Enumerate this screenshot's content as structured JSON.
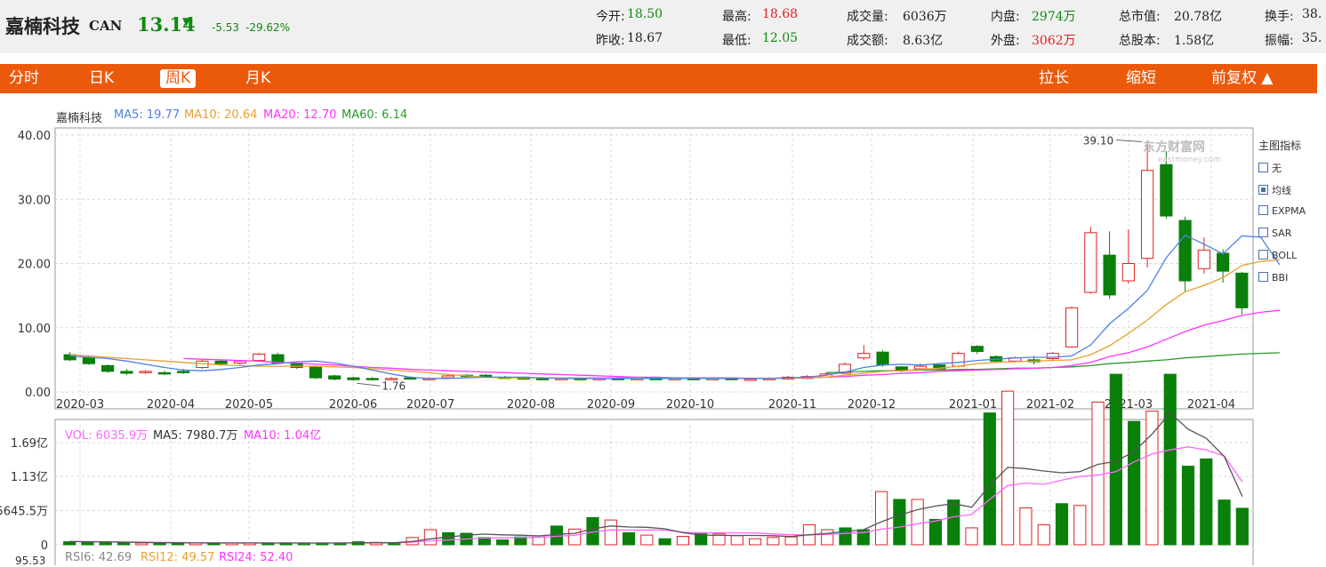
{
  "quote": {
    "name": "嘉楠科技",
    "code": "CAN",
    "price": "13.14",
    "change": "-5.53",
    "change_pct": "-29.62%",
    "arrow": "▼",
    "open_label": "今开:",
    "open": "18.50",
    "prev_close_label": "昨收:",
    "prev_close": "18.67",
    "high_label": "最高:",
    "high": "18.68",
    "low_label": "最低:",
    "low": "12.05",
    "volume_label": "成交量:",
    "volume": "6036万",
    "amount_label": "成交额:",
    "amount": "8.63亿",
    "inner_label": "内盘:",
    "inner": "2974万",
    "outer_label": "外盘:",
    "outer": "3062万",
    "mktcap_label": "总市值:",
    "mktcap": "20.78亿",
    "shares_label": "总股本:",
    "shares": "1.58亿",
    "turnover_label": "换手:",
    "turnover": "38.",
    "amplitude_label": "振幅:",
    "amplitude": "35."
  },
  "toolbar": {
    "tabs": [
      "分时",
      "日K",
      "周K",
      "月K"
    ],
    "active_tab": "周K",
    "stretch": "拉长",
    "shrink": "缩短",
    "adjust": "前复权 ▲"
  },
  "main_legend": {
    "name": "嘉楠科技",
    "ma5": "MA5: 19.77",
    "ma10": "MA10: 20.64",
    "ma20": "MA20: 12.70",
    "ma60": "MA60: 6.14"
  },
  "vol_legend": {
    "vol": "VOL: 6035.9万",
    "ma5": "MA5: 7980.7万",
    "ma10": "MA10: 1.04亿"
  },
  "rsi_legend": {
    "rsi6": "RSI6: 42.69",
    "rsi12": "RSI12: 49.57",
    "rsi24": "RSI24: 52.40",
    "top_tick": "95.53"
  },
  "indicators": {
    "title": "主图指标",
    "items": [
      {
        "label": "无",
        "checked": false
      },
      {
        "label": "均线",
        "checked": true
      },
      {
        "label": "EXPMA",
        "checked": false
      },
      {
        "label": "SAR",
        "checked": false
      },
      {
        "label": "BOLL",
        "checked": false
      },
      {
        "label": "BBI",
        "checked": false
      }
    ]
  },
  "watermark": {
    "cn": "东方财富网",
    "en": "eastmoney.com"
  },
  "colors": {
    "up": "#e02020",
    "down": "#0a7f0a",
    "ma5": "#4f80e8",
    "ma10": "#e8a030",
    "ma20": "#ff33ff",
    "ma60": "#2a9a2a",
    "accent": "#eb5a0b"
  },
  "chart_data": [
    {
      "type": "candlestick",
      "title": "",
      "y_ticks": [
        "40.00",
        "30.00",
        "20.00",
        "10.00",
        "0.00"
      ],
      "ylim": [
        0,
        41
      ],
      "x_ticks": [
        "2020-03",
        "2020-04",
        "2020-05",
        "2020-06",
        "2020-07",
        "2020-08",
        "2020-09",
        "2020-10",
        "2020-11",
        "2020-12",
        "2021-01",
        "2021-02",
        "2021-03",
        "2021-04"
      ],
      "annotations": [
        {
          "text": "39.10"
        },
        {
          "text": "1.76"
        }
      ],
      "candles": [
        [
          5.8,
          5.0,
          6.2,
          4.8
        ],
        [
          5.3,
          4.4,
          5.6,
          4.2
        ],
        [
          4.1,
          3.2,
          4.3,
          3.0
        ],
        [
          3.2,
          2.9,
          3.6,
          2.6
        ],
        [
          3.0,
          3.2,
          3.4,
          2.8
        ],
        [
          3.0,
          2.8,
          3.3,
          2.6
        ],
        [
          3.2,
          3.0,
          3.6,
          2.8
        ],
        [
          3.8,
          4.8,
          5.0,
          3.6
        ],
        [
          4.8,
          4.4,
          5.1,
          4.1
        ],
        [
          4.5,
          4.8,
          5.0,
          4.2
        ],
        [
          4.9,
          5.9,
          6.1,
          4.7
        ],
        [
          5.8,
          4.5,
          6.1,
          4.3
        ],
        [
          4.5,
          3.8,
          4.6,
          3.6
        ],
        [
          3.9,
          2.2,
          4.1,
          2.0
        ],
        [
          2.5,
          2.0,
          2.7,
          1.8
        ],
        [
          2.2,
          1.9,
          2.4,
          1.76
        ],
        [
          2.1,
          2.0,
          2.3,
          1.8
        ],
        [
          2.0,
          2.1,
          2.3,
          1.8
        ],
        [
          2.2,
          2.0,
          2.4,
          1.9
        ],
        [
          2.0,
          2.1,
          2.3,
          1.9
        ],
        [
          2.2,
          2.5,
          2.8,
          2.1
        ],
        [
          2.6,
          2.5,
          2.8,
          2.3
        ],
        [
          2.6,
          2.3,
          2.8,
          2.2
        ],
        [
          2.3,
          2.2,
          2.5,
          2.1
        ],
        [
          2.3,
          2.0,
          2.4,
          1.9
        ],
        [
          2.1,
          1.9,
          2.3,
          1.8
        ],
        [
          2.0,
          2.1,
          2.2,
          1.9
        ],
        [
          2.1,
          2.0,
          2.2,
          1.8
        ],
        [
          2.0,
          2.1,
          2.3,
          1.9
        ],
        [
          2.1,
          2.0,
          2.2,
          1.9
        ],
        [
          2.0,
          2.1,
          2.2,
          1.9
        ],
        [
          2.1,
          2.0,
          2.2,
          1.9
        ],
        [
          2.0,
          2.1,
          2.3,
          1.9
        ],
        [
          2.1,
          2.0,
          2.2,
          1.9
        ],
        [
          2.0,
          2.1,
          2.2,
          1.9
        ],
        [
          2.1,
          2.0,
          2.2,
          1.9
        ],
        [
          1.9,
          2.0,
          2.2,
          1.8
        ],
        [
          2.0,
          2.1,
          2.3,
          1.9
        ],
        [
          2.0,
          2.3,
          2.5,
          1.9
        ],
        [
          2.1,
          2.4,
          2.6,
          2.0
        ],
        [
          2.3,
          2.8,
          3.0,
          2.2
        ],
        [
          2.9,
          4.3,
          4.6,
          2.8
        ],
        [
          5.3,
          6.0,
          7.3,
          5.0
        ],
        [
          6.2,
          4.2,
          6.5,
          3.9
        ],
        [
          3.9,
          3.3,
          4.0,
          3.1
        ],
        [
          3.6,
          4.0,
          4.4,
          3.4
        ],
        [
          4.2,
          3.6,
          4.4,
          3.4
        ],
        [
          4.0,
          6.0,
          6.3,
          3.8
        ],
        [
          7.1,
          6.3,
          7.3,
          5.9
        ],
        [
          5.5,
          4.8,
          5.7,
          4.6
        ],
        [
          4.8,
          5.3,
          5.5,
          4.6
        ],
        [
          5.0,
          4.7,
          5.6,
          4.3
        ],
        [
          5.2,
          6.0,
          6.2,
          4.8
        ],
        [
          7.0,
          13.1,
          13.3,
          6.9
        ],
        [
          15.5,
          24.8,
          25.7,
          15.3
        ],
        [
          21.3,
          15.1,
          25.0,
          14.5
        ],
        [
          17.3,
          20.0,
          25.3,
          16.9
        ],
        [
          20.8,
          34.5,
          39.1,
          19.4
        ],
        [
          35.4,
          27.4,
          37.5,
          27.0
        ],
        [
          26.7,
          17.3,
          27.3,
          15.6
        ],
        [
          19.2,
          22.1,
          24.1,
          18.4
        ],
        [
          21.6,
          18.8,
          22.2,
          17.0
        ],
        [
          18.5,
          13.1,
          18.7,
          12.05
        ]
      ],
      "ma5": [
        5.6,
        5.4,
        5.2,
        4.8,
        4.3,
        3.8,
        3.4,
        3.3,
        3.5,
        3.8,
        4.2,
        4.4,
        4.7,
        4.8,
        4.5,
        4.0,
        3.4,
        2.8,
        2.3,
        2.1,
        2.1,
        2.2,
        2.3,
        2.3,
        2.3,
        2.2,
        2.1,
        2.1,
        2.1,
        2.1,
        2.1,
        2.1,
        2.1,
        2.1,
        2.1,
        2.1,
        2.1,
        2.1,
        2.2,
        2.3,
        2.6,
        3.1,
        3.8,
        4.2,
        4.3,
        4.2,
        4.4,
        4.6,
        4.9,
        5.1,
        5.3,
        5.4,
        5.4,
        5.6,
        7.3,
        10.6,
        13.0,
        15.8,
        20.9,
        24.4,
        23.0,
        21.5,
        24.3,
        24.1,
        19.8
      ],
      "ma10": [
        5.8,
        5.6,
        5.4,
        5.2,
        5.0,
        4.8,
        4.6,
        4.4,
        4.2,
        4.1,
        4.0,
        4.0,
        4.0,
        4.0,
        3.9,
        3.8,
        3.6,
        3.4,
        3.2,
        3.0,
        2.7,
        2.5,
        2.3,
        2.2,
        2.2,
        2.2,
        2.2,
        2.2,
        2.2,
        2.2,
        2.2,
        2.1,
        2.1,
        2.1,
        2.1,
        2.1,
        2.1,
        2.1,
        2.1,
        2.2,
        2.3,
        2.6,
        2.9,
        3.2,
        3.3,
        3.5,
        3.7,
        4.0,
        4.4,
        4.6,
        4.7,
        4.8,
        4.9,
        5.0,
        5.8,
        7.2,
        9.1,
        11.2,
        13.6,
        15.6,
        16.6,
        17.8,
        19.7,
        20.3,
        20.6
      ],
      "ma20": [
        null,
        null,
        null,
        null,
        null,
        null,
        5.2,
        5.1,
        5.0,
        4.9,
        4.8,
        4.6,
        4.5,
        4.3,
        4.2,
        4.0,
        3.8,
        3.7,
        3.5,
        3.4,
        3.3,
        3.2,
        3.1,
        3.0,
        2.9,
        2.8,
        2.7,
        2.6,
        2.5,
        2.4,
        2.3,
        2.3,
        2.2,
        2.2,
        2.2,
        2.2,
        2.1,
        2.1,
        2.2,
        2.2,
        2.3,
        2.4,
        2.6,
        2.7,
        2.9,
        3.0,
        3.2,
        3.3,
        3.4,
        3.5,
        3.6,
        3.7,
        3.8,
        4.1,
        4.6,
        5.5,
        6.1,
        7.0,
        8.2,
        9.4,
        10.4,
        11.1,
        11.9,
        12.4,
        12.7
      ],
      "ma60": [
        null,
        null,
        null,
        null,
        null,
        null,
        null,
        null,
        null,
        null,
        null,
        null,
        null,
        null,
        null,
        null,
        null,
        null,
        null,
        null,
        null,
        null,
        null,
        null,
        null,
        null,
        null,
        null,
        null,
        null,
        null,
        null,
        null,
        null,
        null,
        null,
        null,
        null,
        null,
        null,
        3.0,
        3.1,
        3.2,
        3.3,
        3.3,
        3.4,
        3.4,
        3.5,
        3.5,
        3.6,
        3.7,
        3.7,
        3.8,
        3.9,
        4.1,
        4.4,
        4.6,
        4.8,
        5.0,
        5.3,
        5.5,
        5.7,
        5.9,
        6.0,
        6.1
      ]
    },
    {
      "type": "bar",
      "title": "",
      "unit": "万",
      "y_ticks": [
        "1.69亿",
        "1.13亿",
        "5645.5万",
        "0"
      ],
      "ylim": [
        0,
        16900
      ],
      "values": [
        500,
        500,
        400,
        300,
        300,
        300,
        300,
        300,
        300,
        300,
        300,
        300,
        300,
        300,
        300,
        300,
        500,
        400,
        300,
        1200,
        2500,
        2000,
        1900,
        1200,
        800,
        1300,
        1500,
        3100,
        2600,
        4500,
        4100,
        2000,
        1600,
        1000,
        1400,
        2000,
        1800,
        1500,
        1000,
        1200,
        1300,
        3300,
        2500,
        2800,
        2500,
        8800,
        7500,
        7500,
        4200,
        7400,
        2800,
        21800,
        25400,
        6100,
        3300,
        6800,
        6500,
        23600,
        28200,
        20400,
        22100,
        28200,
        13000,
        14200,
        7400,
        6036
      ],
      "ma5": [
        550,
        520,
        480,
        430,
        380,
        340,
        320,
        310,
        300,
        300,
        300,
        300,
        300,
        300,
        300,
        300,
        330,
        340,
        340,
        540,
        980,
        1280,
        1580,
        1760,
        1640,
        1580,
        1460,
        1720,
        1900,
        2640,
        3120,
        2940,
        2900,
        2640,
        2020,
        1600,
        1560,
        1540,
        1540,
        1500,
        1360,
        1660,
        1860,
        2220,
        2480,
        3800,
        4900,
        5800,
        6400,
        6800,
        6200,
        9800,
        12800,
        12600,
        12200,
        11900,
        12100,
        13300,
        13800,
        15400,
        18300,
        21800,
        19100,
        17600,
        14600,
        7980
      ],
      "ma10": [
        540,
        520,
        500,
        470,
        440,
        400,
        380,
        360,
        340,
        330,
        320,
        310,
        305,
        300,
        300,
        300,
        310,
        320,
        330,
        420,
        640,
        800,
        950,
        1120,
        1140,
        1230,
        1220,
        1400,
        1590,
        2120,
        2450,
        2420,
        2460,
        2420,
        2070,
        1960,
        1990,
        1970,
        1960,
        1800,
        1680,
        1610,
        1710,
        1880,
        2010,
        2580,
        2920,
        3480,
        3930,
        4630,
        5000,
        7500,
        9800,
        10200,
        10000,
        10700,
        11300,
        11500,
        12100,
        13700,
        15000,
        15700,
        16200,
        15700,
        14700,
        10400
      ]
    }
  ]
}
